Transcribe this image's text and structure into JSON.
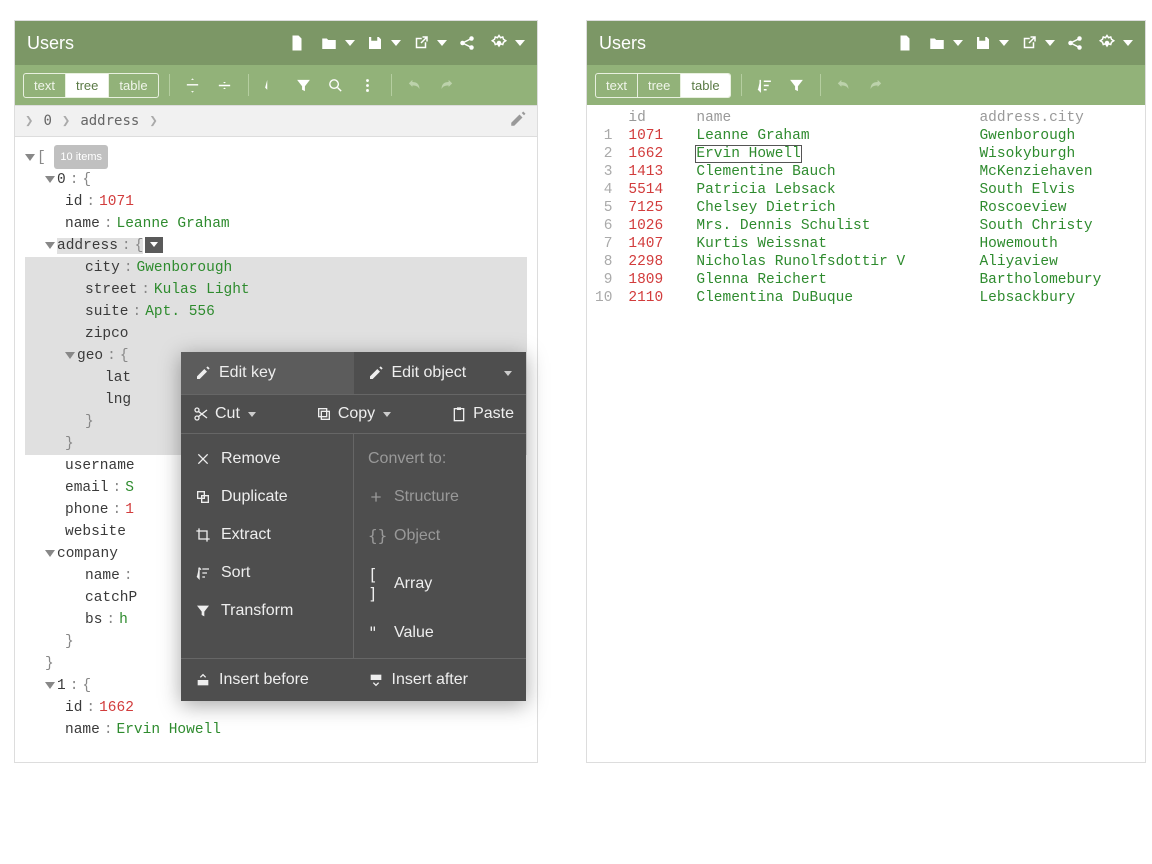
{
  "left": {
    "title": "Users",
    "modes": {
      "text": "text",
      "tree": "tree",
      "table": "table",
      "active": "tree"
    },
    "breadcrumb": {
      "idx": "0",
      "field": "address"
    },
    "root_badge": "10 items",
    "item0": {
      "idx": "0",
      "id_key": "id",
      "id_val": "1071",
      "name_key": "name",
      "name_val": "Leanne Graham",
      "address_key": "address",
      "city_key": "city",
      "city_val": "Gwenborough",
      "street_key": "street",
      "street_val": "Kulas Light",
      "suite_key": "suite",
      "suite_val": "Apt. 556",
      "zip_key": "zipco",
      "geo_key": "geo",
      "lat_key": "lat",
      "lng_key": "lng",
      "username_key": "username",
      "email_key": "email",
      "email_prefix": "S",
      "phone_key": "phone",
      "phone_prefix": "1",
      "website_key": "website",
      "company_key": "company",
      "company_name_key": "name",
      "catch_key": "catchP",
      "bs_key": "bs",
      "bs_prefix": "h"
    },
    "item1": {
      "idx": "1",
      "id_key": "id",
      "id_val": "1662",
      "name_key": "name",
      "name_val": "Ervin Howell"
    }
  },
  "ctx": {
    "edit_key": "Edit key",
    "edit_object": "Edit object",
    "cut": "Cut",
    "copy": "Copy",
    "paste": "Paste",
    "remove": "Remove",
    "duplicate": "Duplicate",
    "extract": "Extract",
    "sort": "Sort",
    "transform": "Transform",
    "convert_to": "Convert to:",
    "structure": "Structure",
    "object": "Object",
    "array": "Array",
    "value": "Value",
    "insert_before": "Insert before",
    "insert_after": "Insert after"
  },
  "right": {
    "title": "Users",
    "modes": {
      "text": "text",
      "tree": "tree",
      "table": "table",
      "active": "table"
    },
    "headers": {
      "id": "id",
      "name": "name",
      "city": "address.city"
    },
    "rows": [
      {
        "n": "1",
        "id": "1071",
        "name": "Leanne Graham",
        "city": "Gwenborough"
      },
      {
        "n": "2",
        "id": "1662",
        "name": "Ervin Howell",
        "city": "Wisokyburgh"
      },
      {
        "n": "3",
        "id": "1413",
        "name": "Clementine Bauch",
        "city": "McKenziehaven"
      },
      {
        "n": "4",
        "id": "5514",
        "name": "Patricia Lebsack",
        "city": "South Elvis"
      },
      {
        "n": "5",
        "id": "7125",
        "name": "Chelsey Dietrich",
        "city": "Roscoeview"
      },
      {
        "n": "6",
        "id": "1026",
        "name": "Mrs. Dennis Schulist",
        "city": "South Christy"
      },
      {
        "n": "7",
        "id": "1407",
        "name": "Kurtis Weissnat",
        "city": "Howemouth"
      },
      {
        "n": "8",
        "id": "2298",
        "name": "Nicholas Runolfsdottir V",
        "city": "Aliyaview"
      },
      {
        "n": "9",
        "id": "1809",
        "name": "Glenna Reichert",
        "city": "Bartholomebury"
      },
      {
        "n": "10",
        "id": "2110",
        "name": "Clementina DuBuque",
        "city": "Lebsackbury"
      }
    ]
  }
}
